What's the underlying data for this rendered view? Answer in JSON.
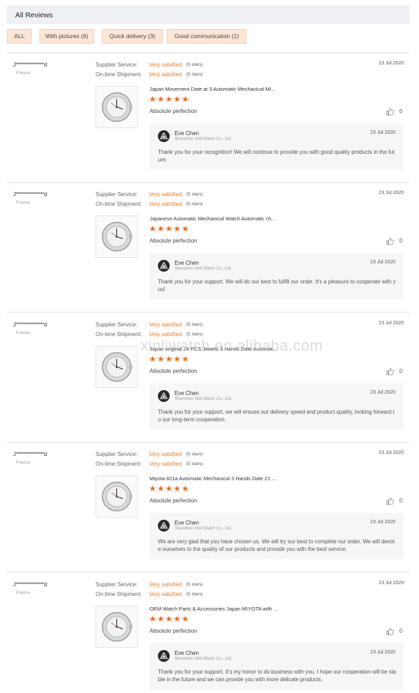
{
  "header": {
    "title": "All Reviews"
  },
  "filters": {
    "all": "ALL",
    "pictures": "With pictures (6)",
    "quick": "Quick delivery (3)",
    "communication": "Good communication (1)"
  },
  "labels": {
    "supplier_service": "Supplier Service:",
    "on_time_shipment": "On-time Shipment:",
    "very_satisfied": "Very satisfied",
    "five_stars": "(5 stars)"
  },
  "colors": {
    "accent": "#f27a1a",
    "star": "#f26b1d",
    "chip_bg": "#fde6d6"
  },
  "watermark": "xinliwatch.en.alibaba.com",
  "reviews": [
    {
      "buyer": "J**************d",
      "country": "France",
      "date": "23 Jul 2020",
      "product": "Japan Movement Date at 3 Automatic Mechanical MI...",
      "rating": 5,
      "text": "Absolute perfection",
      "likes": "0",
      "reply": {
        "name": "Eve Chen",
        "company": "Shenzhen Xinli Watch Co., Ltd.",
        "date": "23 Jul 2020",
        "text": "Thank you for your recognition! We will continue to provide you with good quality products in the future."
      }
    },
    {
      "buyer": "J**************d",
      "country": "France",
      "date": "23 Jul 2020",
      "product": "Japanese Automatic Mechanical Watch Automatic ch...",
      "rating": 5,
      "text": "Absolute perfection",
      "likes": "0",
      "reply": {
        "name": "Eve Chen",
        "company": "Shenzhen Xinli Watch Co., Ltd.",
        "date": "23 Jul 2020",
        "text": "Thank you for your support. We will do our best to fulfill our order. It's a pleasure to cooperate with you!"
      }
    },
    {
      "buyer": "J**************d",
      "country": "France",
      "date": "23 Jul 2020",
      "product": "Japan original 24 PCS Jewels 3 Hands Date Automat...",
      "rating": 5,
      "text": "Absolute perfection",
      "likes": "0",
      "reply": {
        "name": "Eve Chen",
        "company": "Shenzhen Xinli Watch Co., Ltd.",
        "date": "23 Jul 2020",
        "text": "Thank you for your support, we will ensure our delivery speed and product quality, looking forward to our long-term cooperation."
      }
    },
    {
      "buyer": "J**************d",
      "country": "France",
      "date": "23 Jul 2020",
      "product": "Miyota 821a Automatic Mechanical 3 Hands Date 21 ...",
      "rating": 5,
      "text": "Absolute perfection",
      "likes": "0",
      "reply": {
        "name": "Eve Chen",
        "company": "Shenzhen Xinli Watch Co., Ltd.",
        "date": "23 Jul 2020",
        "text": "We are very glad that you have chosen us. We will try our best to complete our order. We will devote ourselves to the quality of our products and provide you with the best service."
      }
    },
    {
      "buyer": "J**************d",
      "country": "France",
      "date": "23 Jul 2020",
      "product": "OEM Watch Parts & Accessories Japan MIYOTA with ...",
      "rating": 5,
      "text": "Absolute perfection",
      "likes": "0",
      "reply": {
        "name": "Eve Chen",
        "company": "Shenzhen Xinli Watch Co., Ltd.",
        "date": "23 Jul 2020",
        "text": "Thank you for your support. It's my honor to do business with you. I hope our cooperation will be stable in the future and we can provide you with more delicate products."
      }
    }
  ]
}
